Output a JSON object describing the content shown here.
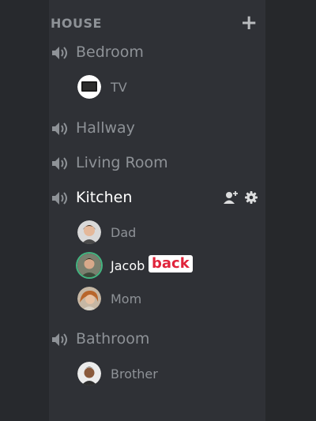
{
  "category": {
    "label": "HOUSE",
    "add_icon": "plus-icon"
  },
  "channels": [
    {
      "name": "Bedroom",
      "icon": "speaker-icon"
    },
    {
      "name": "Hallway",
      "icon": "speaker-icon"
    },
    {
      "name": "Living Room",
      "icon": "speaker-icon"
    },
    {
      "name": "Kitchen",
      "icon": "speaker-icon",
      "active": true,
      "action_icons": [
        "add-person-icon",
        "gear-icon"
      ]
    },
    {
      "name": "Bathroom",
      "icon": "speaker-icon"
    }
  ],
  "members": {
    "bedroom": [
      {
        "name": "TV"
      }
    ],
    "kitchen": [
      {
        "name": "Dad"
      },
      {
        "name": "Jacob",
        "tag": "back",
        "speaking": true
      },
      {
        "name": "Mom"
      }
    ],
    "bathroom": [
      {
        "name": "Brother"
      }
    ]
  },
  "colors": {
    "speaking_ring": "#43b581",
    "tag_text": "#e0243b",
    "muted_text": "#8e9297",
    "active_text": "#ffffff"
  }
}
